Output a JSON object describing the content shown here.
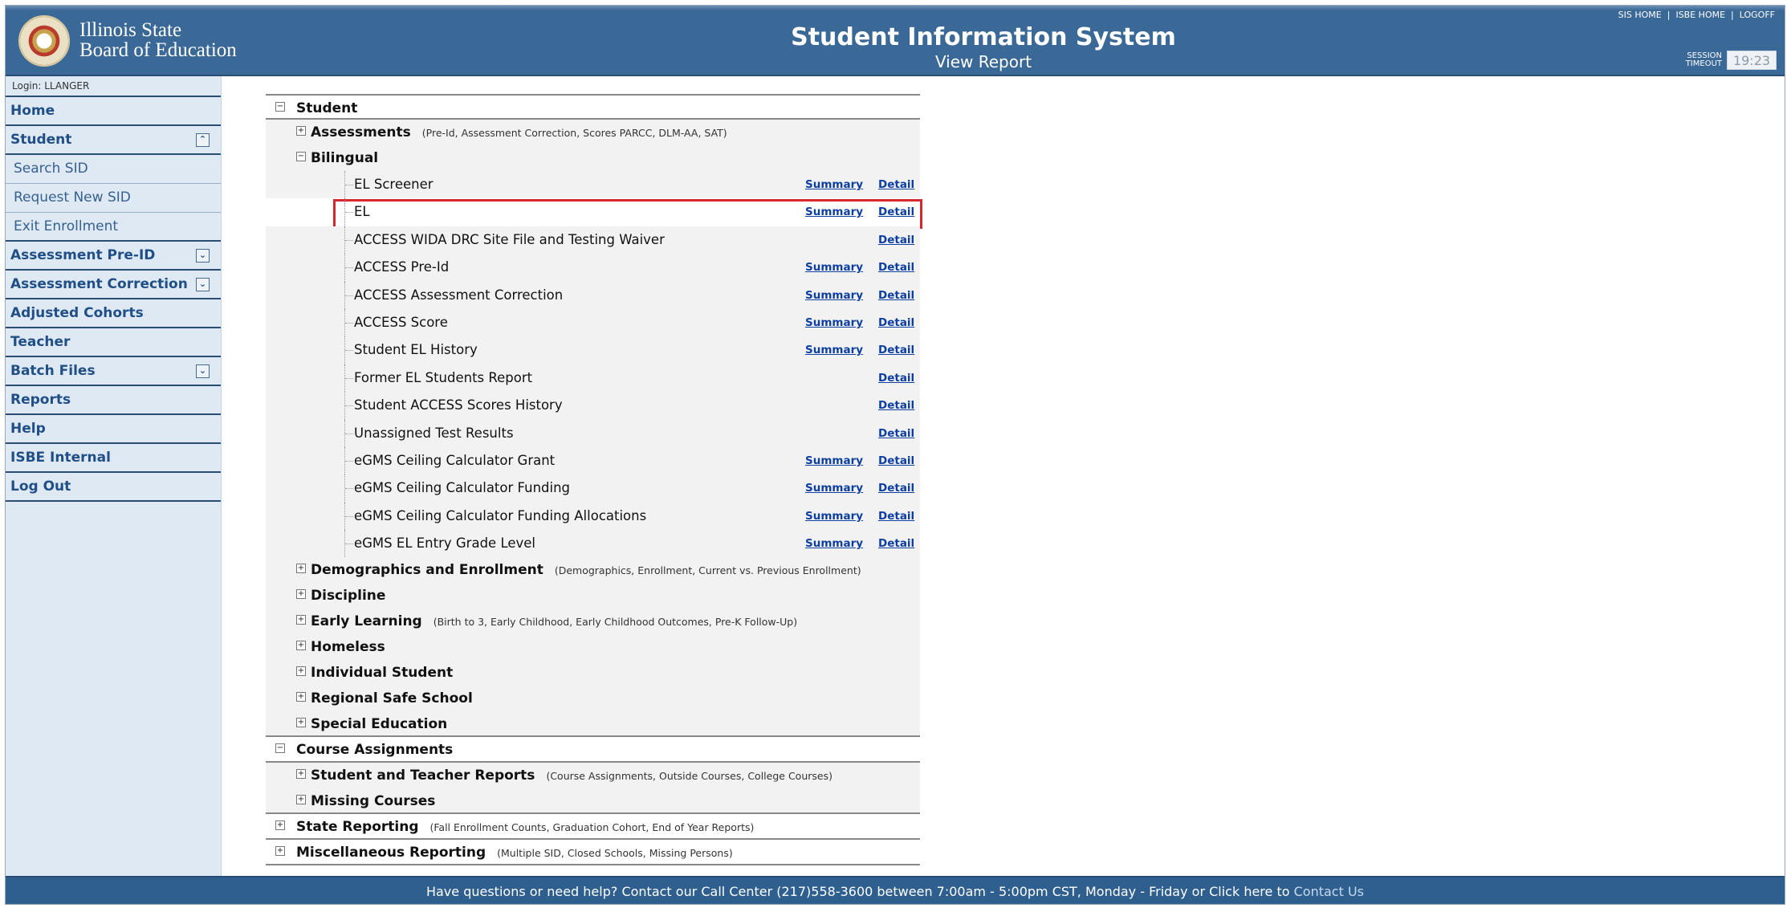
{
  "header": {
    "org_name_line1": "Illinois State",
    "org_name_line2": "Board of Education",
    "title": "Student Information System",
    "subtitle": "View Report",
    "toplinks": [
      "SIS HOME",
      "ISBE HOME",
      "LOGOFF"
    ],
    "session_label_line1": "SESSION",
    "session_label_line2": "TIMEOUT",
    "session_value": "19:23"
  },
  "sidebar": {
    "login": "Login: LLANGER",
    "items": [
      {
        "label": "Home"
      },
      {
        "label": "Student",
        "toggle": "⌃"
      },
      {
        "label": "Search SID"
      },
      {
        "label": "Request New SID"
      },
      {
        "label": "Exit Enrollment"
      },
      {
        "label": "Assessment Pre-ID",
        "toggle": "⌄"
      },
      {
        "label": "Assessment Correction",
        "toggle": "⌄"
      },
      {
        "label": "Adjusted Cohorts"
      },
      {
        "label": "Teacher"
      },
      {
        "label": "Batch Files",
        "toggle": "⌄"
      },
      {
        "label": "Reports"
      },
      {
        "label": "Help"
      },
      {
        "label": "ISBE Internal"
      },
      {
        "label": "Log Out"
      }
    ]
  },
  "tree": {
    "student": "Student",
    "assessments": {
      "label": "Assessments",
      "desc": "(Pre-Id, Assessment Correction, Scores PARCC, DLM-AA, SAT)"
    },
    "bilingual": "Bilingual",
    "summary_label": "Summary",
    "detail_label": "Detail",
    "reports": [
      {
        "name": "EL Screener"
      },
      {
        "name": "EL"
      },
      {
        "name": "ACCESS WIDA DRC Site File and Testing Waiver"
      },
      {
        "name": "ACCESS Pre-Id"
      },
      {
        "name": "ACCESS Assessment Correction"
      },
      {
        "name": "ACCESS Score"
      },
      {
        "name": "Student EL History"
      },
      {
        "name": "Former EL Students Report"
      },
      {
        "name": "Student ACCESS Scores History"
      },
      {
        "name": "Unassigned Test Results"
      },
      {
        "name": "eGMS Ceiling Calculator Grant"
      },
      {
        "name": "eGMS Ceiling Calculator Funding"
      },
      {
        "name": "eGMS Ceiling Calculator Funding Allocations"
      },
      {
        "name": "eGMS EL Entry Grade Level"
      }
    ],
    "demographics": {
      "label": "Demographics and Enrollment",
      "desc": "(Demographics, Enrollment, Current vs. Previous Enrollment)"
    },
    "discipline": "Discipline",
    "early_learning": {
      "label": "Early Learning",
      "desc": "(Birth to 3, Early Childhood, Early Childhood Outcomes, Pre-K Follow-Up)"
    },
    "homeless": "Homeless",
    "individual_student": "Individual Student",
    "regional_safe_school": "Regional Safe School",
    "special_education": "Special Education",
    "course_assignments": "Course Assignments",
    "student_teacher_reports": {
      "label": "Student and Teacher Reports",
      "desc": "(Course Assignments, Outside Courses, College Courses)"
    },
    "missing_courses": "Missing Courses",
    "state_reporting": {
      "label": "State Reporting",
      "desc": "(Fall Enrollment Counts, Graduation Cohort, End of Year Reports)"
    },
    "misc_reporting": {
      "label": "Miscellaneous Reporting",
      "desc": "(Multiple SID, Closed Schools, Missing Persons)"
    }
  },
  "footer": {
    "text": "Have questions or need help? Contact our Call Center (217)558-3600 between 7:00am - 5:00pm CST, Monday - Friday or Click here to",
    "contact_link": "Contact Us"
  }
}
